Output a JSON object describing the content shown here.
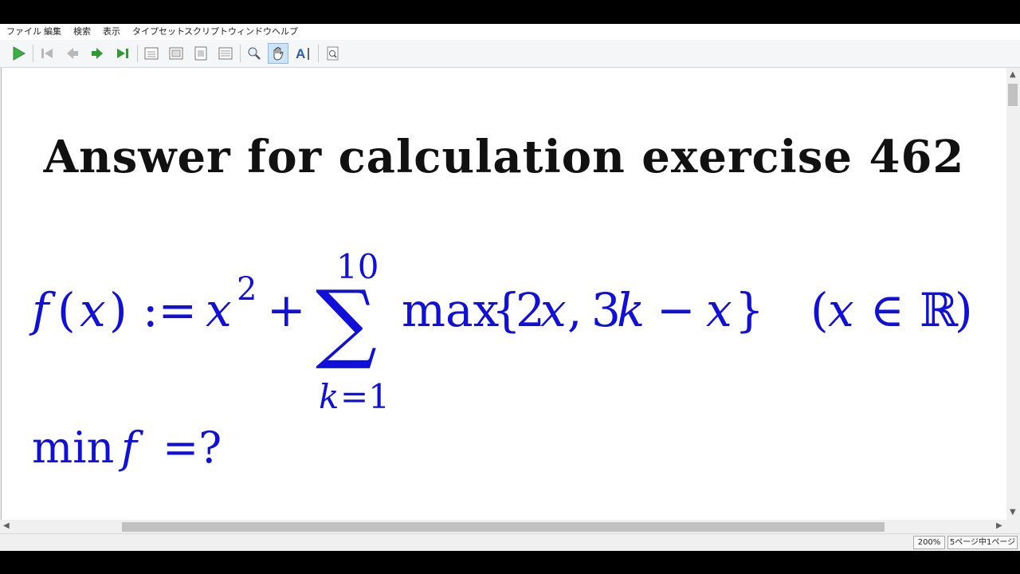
{
  "menu": [
    "ファイル",
    "編集",
    "検索",
    "表示",
    "タイプセット",
    "スクリプト",
    "ウィンドウ",
    "ヘルプ"
  ],
  "toolbar": {
    "buttons": [
      "play-icon",
      "first-page-icon",
      "previous-page-icon",
      "next-page-icon",
      "last-page-icon",
      "single-page-view-icon",
      "continuous-view-icon",
      "fit-page-icon",
      "fit-width-icon",
      "zoom-icon",
      "hand-tool-icon",
      "text-select-icon",
      "magnifier-icon"
    ],
    "active": "hand-tool-icon"
  },
  "document": {
    "title": "Answer for calculation exercise 462",
    "formula": {
      "lhs_f": "f",
      "lhs_paren_open": "(",
      "lhs_x": "x",
      "lhs_paren_close": ")",
      "assign": ":=",
      "x_squared_base": "x",
      "x_squared_exp": "2",
      "plus": "+",
      "sum_symbol": "∑",
      "sum_upper": "10",
      "sum_lower_k": "k",
      "sum_lower_eq": "=1",
      "max_word": "max",
      "brace_open": "{",
      "arg1_num": "2",
      "arg1_var": "x",
      "comma": ",",
      "arg2_num": "3",
      "arg2_var": "k",
      "minus": "−",
      "arg2_x": "x",
      "brace_close": "}",
      "domain_open": "(",
      "domain_x": "x",
      "domain_in": "∈",
      "domain_R": "ℝ",
      "domain_close": ")"
    },
    "question": {
      "min_word": "min",
      "f": "f",
      "rest": "=?"
    },
    "math_color": "#1010d8"
  },
  "status": {
    "zoom": "200%",
    "page_info": "5ページ中1ページ"
  }
}
